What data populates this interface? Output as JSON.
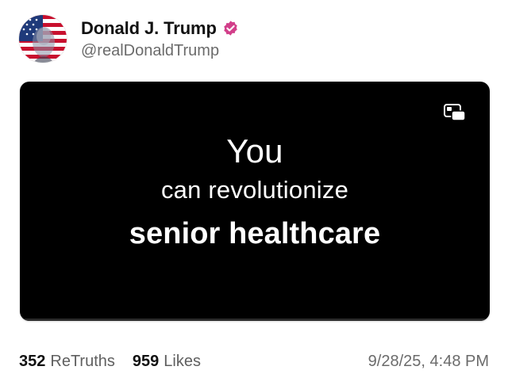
{
  "post": {
    "author": {
      "display_name": "Donald J. Trump",
      "handle": "@realDonaldTrump",
      "verified": true,
      "verified_color": "#d23f8a",
      "avatar_icon": "flag-portrait-avatar"
    },
    "media": {
      "background_color": "#000000",
      "icon": "picture-in-picture-icon",
      "overlay_lines": [
        "You",
        "can revolutionize",
        "senior healthcare"
      ]
    },
    "stats": {
      "retruths_count": "352",
      "retruths_label": "ReTruths",
      "likes_count": "959",
      "likes_label": "Likes"
    },
    "timestamp": "9/28/25, 4:48 PM"
  }
}
